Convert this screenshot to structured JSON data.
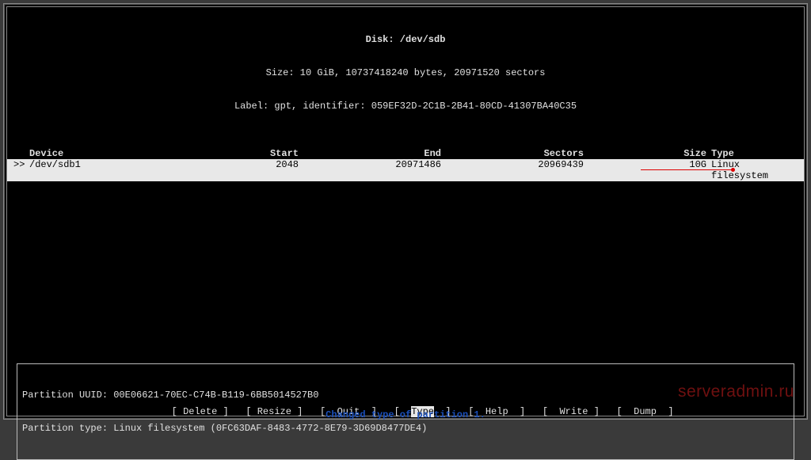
{
  "header": {
    "title_label": "Disk: ",
    "title_value": "/dev/sdb",
    "size_line": "Size: 10 GiB, 10737418240 bytes, 20971520 sectors",
    "label_line": "Label: gpt, identifier: 059EF32D-2C1B-2B41-80CD-41307BA40C35"
  },
  "columns": {
    "device": "Device",
    "start": "Start",
    "end": "End",
    "sectors": "Sectors",
    "size": "Size",
    "type": "Type"
  },
  "row": {
    "marker": ">>",
    "device": "/dev/sdb1",
    "start": "2048",
    "end": "20971486",
    "sectors": "20969439",
    "size": "10G",
    "type": "Linux filesystem"
  },
  "info": {
    "uuid_line": "Partition UUID: 00E06621-70EC-C74B-B119-6BB5014527B0",
    "type_line": "Partition type: Linux filesystem (0FC63DAF-8483-4772-8E79-3D69D8477DE4)"
  },
  "menu": {
    "delete": "Delete",
    "resize": "Resize",
    "quit": "Quit",
    "type": "Type",
    "help": "Help",
    "write": "Write",
    "dump": "Dump"
  },
  "status": "Changed type of partition 1.",
  "watermark": "serveradmin.ru"
}
